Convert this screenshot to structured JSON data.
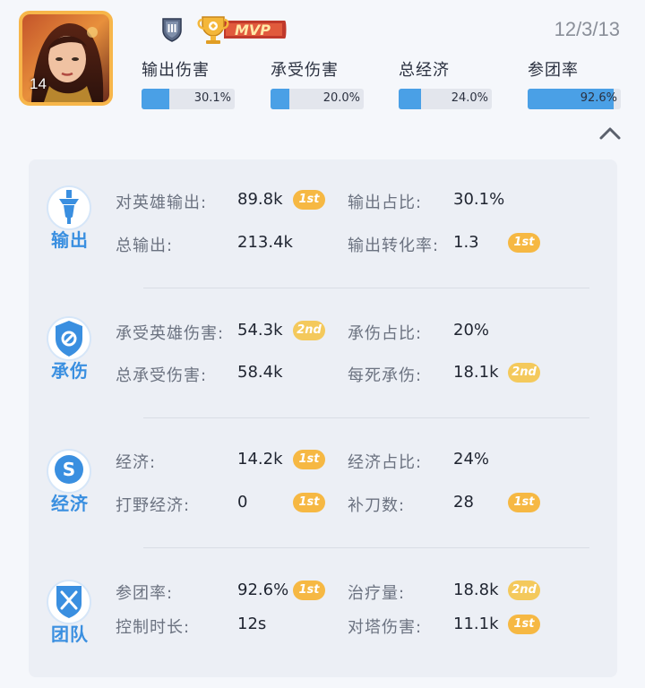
{
  "header": {
    "level": "14",
    "date": "12/3/13",
    "rank_icon": "rank-III-shield-icon",
    "mvp_icon": "mvp-trophy-icon",
    "mvp_label": "MVP",
    "stats": [
      {
        "label": "输出伤害",
        "value": "30.1%",
        "fraction": 0.301
      },
      {
        "label": "承受伤害",
        "value": "20.0%",
        "fraction": 0.2
      },
      {
        "label": "总经济",
        "value": "24.0%",
        "fraction": 0.24
      },
      {
        "label": "参团率",
        "value": "92.6%",
        "fraction": 0.926
      }
    ]
  },
  "colors": {
    "accent_blue": "#4aa0e6",
    "title_blue": "#3a8fe0",
    "avatar_border": "#f7b64a",
    "badge_gold": "#f6b843"
  },
  "sections": [
    {
      "title": "输出",
      "icon": "sword-icon",
      "rows": [
        {
          "label": "对英雄输出:",
          "value": "89.8k",
          "rank": "1st",
          "label2": "输出占比:",
          "value2": "30.1%",
          "rank2": ""
        },
        {
          "label": "总输出:",
          "value": "213.4k",
          "rank": "",
          "label2": "输出转化率:",
          "value2": "1.3",
          "rank2": "1st"
        }
      ]
    },
    {
      "title": "承伤",
      "icon": "shield-icon",
      "rows": [
        {
          "label": "承受英雄伤害:",
          "value": "54.3k",
          "rank": "2nd",
          "label2": "承伤占比:",
          "value2": "20%",
          "rank2": ""
        },
        {
          "label": "总承受伤害:",
          "value": "58.4k",
          "rank": "",
          "label2": "每死承伤:",
          "value2": "18.1k",
          "rank2": "2nd"
        }
      ]
    },
    {
      "title": "经济",
      "icon": "coin-icon",
      "rows": [
        {
          "label": "经济:",
          "value": "14.2k",
          "rank": "1st",
          "label2": "经济占比:",
          "value2": "24%",
          "rank2": ""
        },
        {
          "label": "打野经济:",
          "value": "0",
          "rank": "1st",
          "label2": "补刀数:",
          "value2": "28",
          "rank2": "1st"
        }
      ]
    },
    {
      "title": "团队",
      "icon": "crossed-swords-icon",
      "rows": [
        {
          "label": "参团率:",
          "value": "92.6%",
          "rank": "1st",
          "label2": "治疗量:",
          "value2": "18.8k",
          "rank2": "2nd"
        },
        {
          "label": "控制时长:",
          "value": "12s",
          "rank": "",
          "label2": "对塔伤害:",
          "value2": "11.1k",
          "rank2": "1st"
        }
      ]
    }
  ]
}
